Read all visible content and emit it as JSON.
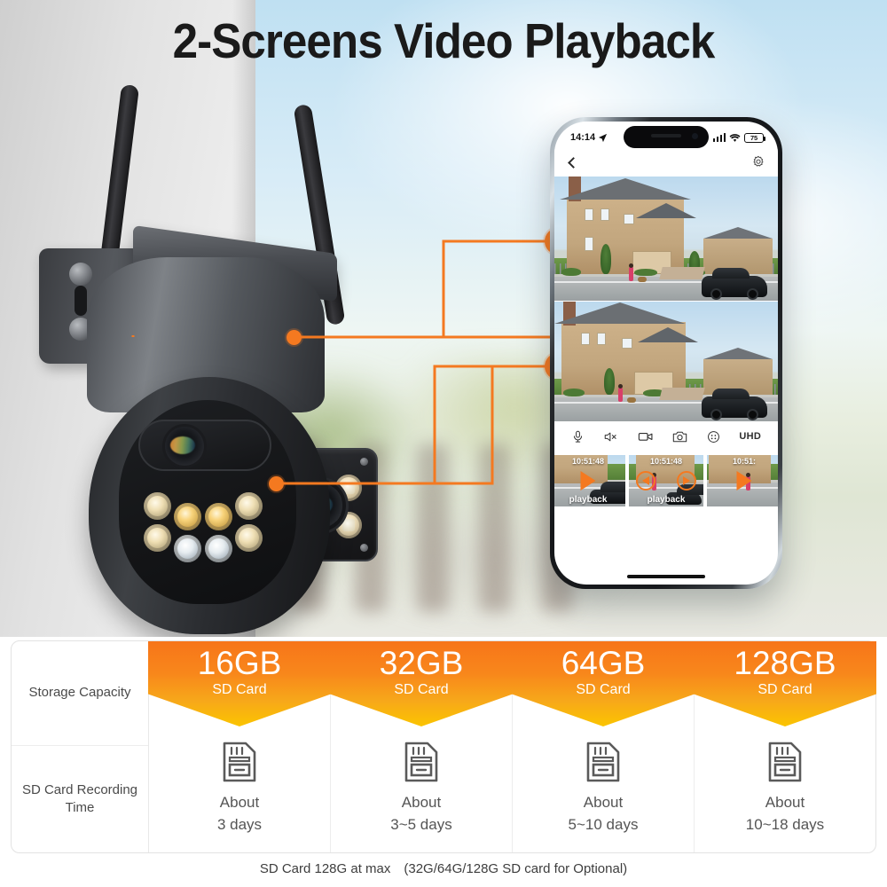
{
  "title": "2-Screens Video Playback",
  "phone": {
    "status_bar": {
      "time": "14:14",
      "location_icon": "location-arrow-icon",
      "signal_icon": "cellular-signal-icon",
      "wifi_icon": "wifi-icon",
      "battery_level": "75"
    },
    "nav": {
      "back_icon": "back-chevron-icon",
      "settings_icon": "gear-icon"
    },
    "feeds": [
      {
        "name": "upper-camera-feed"
      },
      {
        "name": "lower-camera-feed"
      }
    ],
    "controls": [
      {
        "icon": "microphone-icon",
        "label": ""
      },
      {
        "icon": "speaker-mute-icon",
        "label": ""
      },
      {
        "icon": "video-record-icon",
        "label": ""
      },
      {
        "icon": "camera-snapshot-icon",
        "label": ""
      },
      {
        "icon": "resolution-dots-icon",
        "label": ""
      },
      {
        "icon": "uhd-quality-label",
        "label": "UHD"
      }
    ],
    "thumbnails": [
      {
        "timestamp": "10:51:48",
        "label": "playback",
        "control": "play"
      },
      {
        "timestamp": "10:51:48",
        "label": "playback",
        "control": "rewind-forward"
      },
      {
        "timestamp": "10:51:",
        "label": "",
        "control": "play"
      }
    ]
  },
  "table": {
    "row_labels": [
      "Storage Capacity",
      "SD Card Recording Time"
    ],
    "columns": [
      {
        "capacity": "16GB",
        "card_label": "SD Card",
        "about": "About",
        "duration": "3 days"
      },
      {
        "capacity": "32GB",
        "card_label": "SD Card",
        "about": "About",
        "duration": "3~5 days"
      },
      {
        "capacity": "64GB",
        "card_label": "SD Card",
        "about": "About",
        "duration": "5~10 days"
      },
      {
        "capacity": "128GB",
        "card_label": "SD Card",
        "about": "About",
        "duration": "10~18 days"
      }
    ]
  },
  "footnote": "SD Card 128G at max　(32G/64G/128G SD card for Optional)",
  "colors": {
    "accent_orange": "#F47920",
    "banner_top": "#F7751A",
    "banner_bottom": "#FBC400"
  }
}
